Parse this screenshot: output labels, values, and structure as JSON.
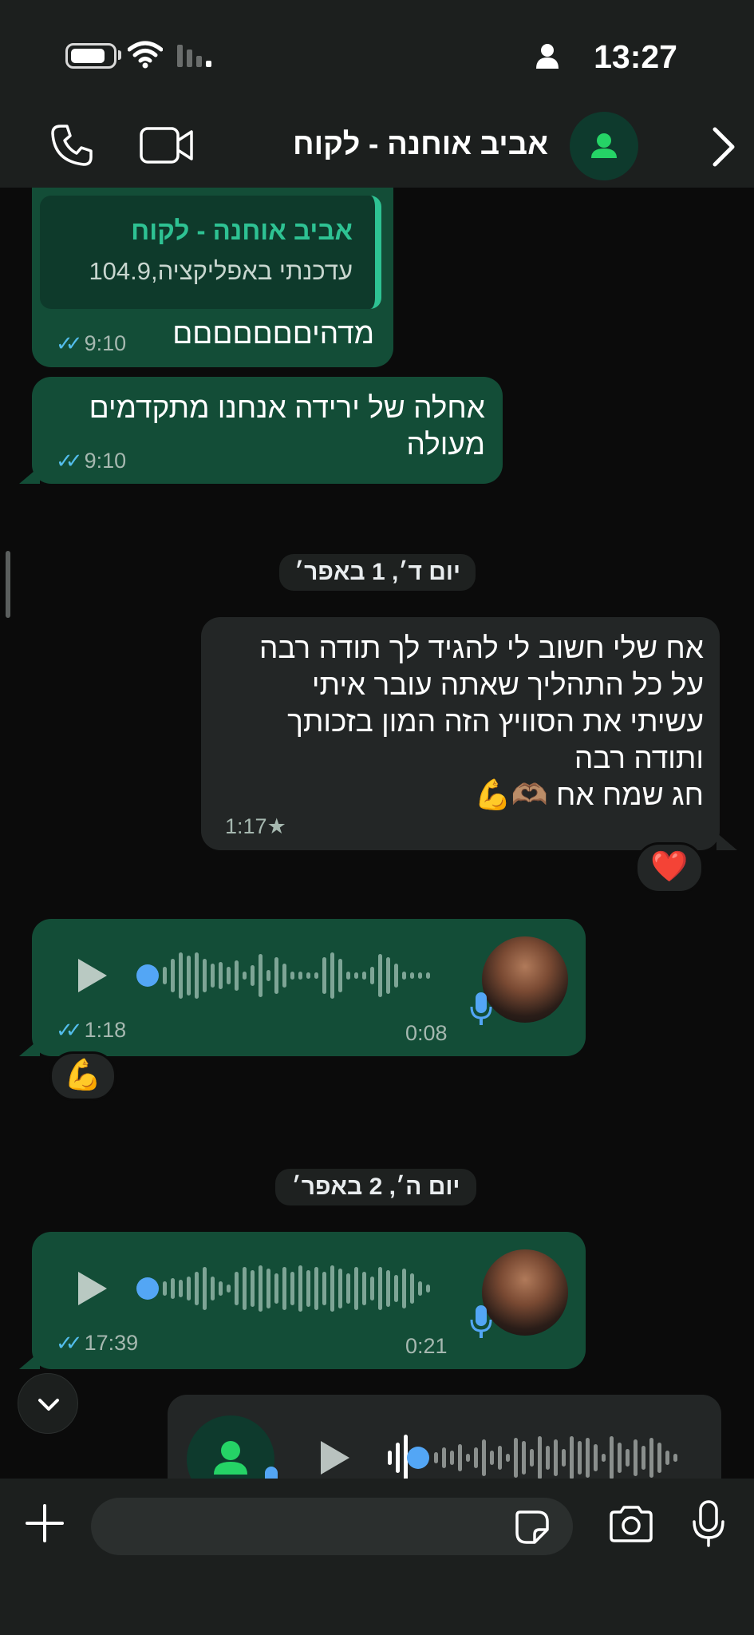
{
  "status_bar": {
    "time": "13:27"
  },
  "header": {
    "title": "אביב אוחנה - לקוח"
  },
  "messages": {
    "m1": {
      "quote_name": "אביב אוחנה - לקוח",
      "quote_text": "עדכנתי באפליקציה,104.9",
      "text": "מדהיםםםםםםם",
      "time": "9:10"
    },
    "m2": {
      "line1": "אחלה של ירידה אנחנו מתקדמים",
      "line2": "מעולה",
      "time": "9:10"
    },
    "date1": "יום ד׳, 1 באפר׳",
    "m3": {
      "line1": "אח שלי חשוב לי להגיד לך תודה רבה",
      "line2": "על כל התהליך שאתה עובר איתי",
      "line3": "עשיתי את הסוויץ הזה המון בזכותך",
      "line4": "ותודה רבה",
      "line5": "חג שמח אח 🫶🏽💪",
      "time": "1:17",
      "star": "★",
      "reaction": "❤️"
    },
    "v1": {
      "duration": "0:08",
      "time": "1:18",
      "reaction": "💪"
    },
    "date2": "יום ה׳, 2 באפר׳",
    "v2": {
      "duration": "0:21",
      "time": "17:39"
    }
  },
  "icons": {
    "ticks": "✓✓"
  },
  "colors": {
    "accent": "#2ec293",
    "incoming_bubble": "#134d37",
    "outgoing_bubble": "#232626",
    "read_ticks": "#53bdeb",
    "play_dot": "#53a6f5"
  }
}
